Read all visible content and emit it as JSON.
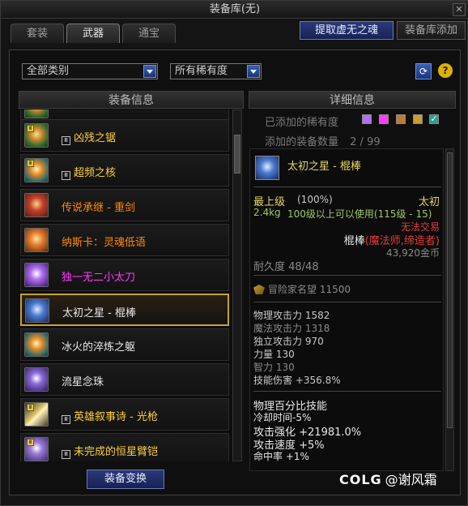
{
  "window": {
    "title": "装备库(无)",
    "close": "✕"
  },
  "tabs": [
    {
      "label": "套装"
    },
    {
      "label": "武器"
    },
    {
      "label": "通宝"
    }
  ],
  "toolbar": {
    "extract_label": "提取虚无之魂",
    "add_label": "装备库添加"
  },
  "filters": {
    "category": "全部类别",
    "rarity": "所有稀有度"
  },
  "left_panel": {
    "header": "装备信息",
    "items": [
      {
        "name": "凶残之锯",
        "sealed": true,
        "icon": "gear-saw-icon"
      },
      {
        "name": "超频之核",
        "sealed": true,
        "icon": "core-icon"
      },
      {
        "name": "传说承继 - 重剑",
        "sealed": false,
        "icon": "greatsword-icon"
      },
      {
        "name": "纳斯卡：灵魂低语",
        "sealed": false,
        "icon": "soul-whisper-icon"
      },
      {
        "name": "独一无二小太刀",
        "sealed": false,
        "icon": "short-katana-icon"
      },
      {
        "name": "太初之星 - 棍棒",
        "sealed": false,
        "icon": "star-rod-icon"
      },
      {
        "name": "冰火的淬炼之躯",
        "sealed": false,
        "icon": "ice-fire-body-icon"
      },
      {
        "name": "流星念珠",
        "sealed": false,
        "icon": "meteor-beads-icon"
      },
      {
        "name": "英雄叙事诗 - 光枪",
        "sealed": true,
        "icon": "light-lance-icon"
      },
      {
        "name": "未完成的恒星臂铠",
        "sealed": true,
        "icon": "stellar-gauntlet-icon"
      }
    ],
    "convert_label": "装备变换"
  },
  "right_panel": {
    "header": "详细信息",
    "rarity_label": "已添加的稀有度",
    "count_label": "添加的装备数量",
    "count_value": "2 / 99",
    "detail": {
      "name": "太初之星 - 棍棒",
      "grade": "最上级",
      "grade_pct": "(100%)",
      "rarity": "太初",
      "weight": "2.4kg",
      "level_req": "100级以上可以使用(115级 - 15)",
      "trade": "无法交易",
      "type_prefix": "棍棒",
      "classes": "(魔法师,缔造者)",
      "price": "43,920金币",
      "durability": "耐久度 48/48",
      "fame": "冒险家名望  11500",
      "stats": [
        {
          "text": "物理攻击力 1582",
          "style": "lgray"
        },
        {
          "text": "魔法攻击力 1318",
          "style": "gray"
        },
        {
          "text": "独立攻击力 970",
          "style": "lgray"
        },
        {
          "text": "力量 130",
          "style": "lgray"
        },
        {
          "text": "智力 130",
          "style": "gray"
        },
        {
          "text": "技能伤害 +356.8%",
          "style": "lgray"
        }
      ],
      "bonus_title": "物理百分比技能",
      "bonus": [
        " 冷却时间-5%",
        "攻击强化 +21981.0%",
        "攻击速度 +5%",
        "命中率 +1%"
      ]
    }
  },
  "watermark": {
    "logo": "COLG",
    "text": "@谢风霜"
  }
}
